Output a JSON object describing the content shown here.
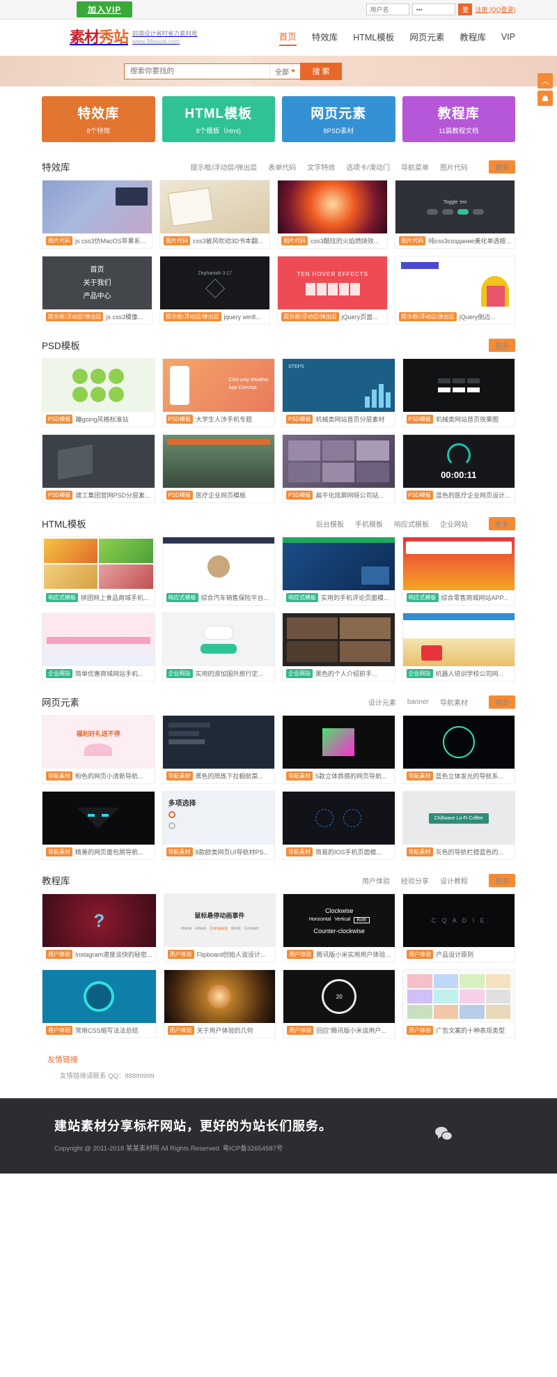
{
  "topbar": {
    "vip_label": "加入VIP",
    "username_placeholder": "用户名",
    "password_value": "•••",
    "login_button": "登",
    "register_label": "注册 [QQ登录]"
  },
  "header": {
    "logo_main": "素材",
    "logo_accent": "秀站",
    "tagline": "前端设计省时省力素材库",
    "site_url": "www.98sucai.com",
    "nav": [
      {
        "label": "首页",
        "active": true
      },
      {
        "label": "特效库",
        "active": false
      },
      {
        "label": "HTML模板",
        "active": false
      },
      {
        "label": "网页元素",
        "active": false
      },
      {
        "label": "教程库",
        "active": false
      },
      {
        "label": "VIP",
        "active": false
      }
    ]
  },
  "search": {
    "placeholder": "搜索你要找的",
    "scope": "全部",
    "button": "搜 索"
  },
  "cards": [
    {
      "title": "特效库",
      "sub": "8个特效",
      "color": "#e2752f"
    },
    {
      "title": "HTML模板",
      "sub": "8个模板（html)",
      "color": "#2fc295"
    },
    {
      "title": "网页元素",
      "sub": "8PSD素材",
      "color": "#3492d4"
    },
    {
      "title": "教程库",
      "sub": "11篇教程文档",
      "color": "#b557d6"
    }
  ],
  "more_label": "更多",
  "sections": [
    {
      "title": "特效库",
      "tags": [
        "提示框/浮动层/弹出层",
        "表单代码",
        "文字特效",
        "选项卡/滑动门",
        "导航菜单",
        "图片代码"
      ],
      "items": [
        {
          "badge": "图片代码",
          "text": "js css3仿MacOS苹果系..."
        },
        {
          "badge": "图片代码",
          "text": "css3被风吹动3D书本翻..."
        },
        {
          "badge": "图片代码",
          "text": "css3酷炫的火焰燃烧效..."
        },
        {
          "badge": "图片代码",
          "text": "纯css3создание美化单选按..."
        },
        {
          "badge": "提示框/浮动层/弹出层",
          "text": "js css3模像..."
        },
        {
          "badge": "提示框/浮动层/弹出层",
          "text": "jquery win8..."
        },
        {
          "badge": "提示框/浮动层/弹出层",
          "text": "jQuery页面..."
        },
        {
          "badge": "提示框/浮动层/弹出层",
          "text": "jQuery侧边..."
        }
      ]
    },
    {
      "title": "PSD模板",
      "tags": [],
      "items": [
        {
          "badge": "PSD模板",
          "text": "蹦going风格标准站"
        },
        {
          "badge": "PSD模板",
          "text": "大学生人涉手机专题"
        },
        {
          "badge": "PSD模板",
          "text": "机械类网站首页分层素材"
        },
        {
          "badge": "PSD模板",
          "text": "机械类网站首页效果图"
        },
        {
          "badge": "PSD模板",
          "text": "建工集团官网PSD分层素..."
        },
        {
          "badge": "PSD模板",
          "text": "医疗企业网页模板"
        },
        {
          "badge": "PSD模板",
          "text": "扁平化炫屏网呀公司站..."
        },
        {
          "badge": "PSD模板",
          "text": "蓝色的医疗企业网页设计..."
        }
      ]
    },
    {
      "title": "HTML模板",
      "tags": [
        "后台模板",
        "手机模板",
        "响应式模板",
        "企业网站"
      ],
      "items": [
        {
          "badge": "响应式模板",
          "text": "拼团网上食品商城手机..."
        },
        {
          "badge": "响应式模板",
          "text": "综合汽车销售保险平台..."
        },
        {
          "badge": "响应式模板",
          "text": "实用的手机评论页面模..."
        },
        {
          "badge": "响应式模板",
          "text": "综合零售商城网站APP..."
        },
        {
          "badge": "企业网站",
          "text": "简单优惠商城网站手机..."
        },
        {
          "badge": "企业网站",
          "text": "实用的游加国外旅行定..."
        },
        {
          "badge": "企业网站",
          "text": "黑色的个人介绍前手..."
        },
        {
          "badge": "企业网站",
          "text": "机器人培训学校公司网..."
        }
      ]
    },
    {
      "title": "网页元素",
      "tags": [
        "设计元素",
        "banner",
        "导航素材"
      ],
      "items": [
        {
          "badge": "导航素材",
          "text": "粉色的网页小清新导航..."
        },
        {
          "badge": "导航素材",
          "text": "黑色的简炼下拉橱航菜..."
        },
        {
          "badge": "导航素材",
          "text": "5款立体质感的网页导航..."
        },
        {
          "badge": "导航素材",
          "text": "蓝色立体发光的导航系..."
        },
        {
          "badge": "导航素材",
          "text": "精美的网页面包屑导航..."
        },
        {
          "badge": "导航素材",
          "text": "8款欧类网页UI导航材PS..."
        },
        {
          "badge": "导航素材",
          "text": "简易的IOS手机页面框..."
        },
        {
          "badge": "导航素材",
          "text": "灰色的导航栏搭蓝色的..."
        }
      ]
    },
    {
      "title": "教程库",
      "tags": [
        "用户体验",
        "经验分享",
        "设计教程"
      ],
      "items": [
        {
          "badge": "用户体验",
          "text": "Instagram速度谈快的秘密..."
        },
        {
          "badge": "用户体验",
          "text": "Flipboard创始人谈设计..."
        },
        {
          "badge": "用户体验",
          "text": "腾讯版小米实用用户体验..."
        },
        {
          "badge": "用户体验",
          "text": "产品设计原则"
        },
        {
          "badge": "用户体验",
          "text": "常用CSS缩写法法总结"
        },
        {
          "badge": "用户体验",
          "text": "关于用户体验的几何"
        },
        {
          "badge": "用户体验",
          "text": "回应“腾讯版小米谈用户..."
        },
        {
          "badge": "用户体验",
          "text": "广告文案的十种表现类型"
        }
      ]
    }
  ],
  "friendly_links": {
    "title": "友情链接",
    "contact": "友情链接请联系 QQ：88889999"
  },
  "footer": {
    "slogan": "建站素材分享标杆网站，更好的为站长们服务。",
    "copyright": "Copyright @ 2011-2018 某某素材网 All Rights Reserved. 粤ICP备32654587号",
    "wechat_icon": "wechat-icon"
  },
  "float_buttons": [
    {
      "icon": "arrow-up-icon",
      "glyph": "︿"
    },
    {
      "icon": "user-icon",
      "glyph": "☗"
    }
  ]
}
